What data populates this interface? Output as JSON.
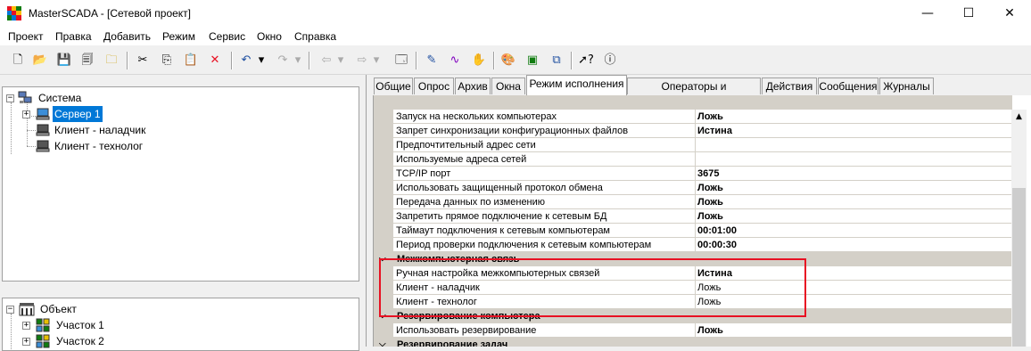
{
  "window": {
    "title": "MasterSCADA - [Сетевой проект]",
    "minimize": "—",
    "maximize": "☐",
    "close": "✕"
  },
  "menu": [
    "Проект",
    "Правка",
    "Добавить",
    "Режим",
    "Сервис",
    "Окно",
    "Справка"
  ],
  "toolbar": {
    "icons": [
      "new-file-icon",
      "open-folder-icon",
      "save-icon",
      "save-all-icon",
      "export-icon",
      "cut-icon",
      "copy-icon",
      "paste-icon",
      "delete-icon",
      "undo-icon",
      "undo-dropdown-icon",
      "redo-icon",
      "redo-dropdown-icon",
      "back-icon",
      "back-dropdown-icon",
      "forward-icon",
      "forward-dropdown-icon",
      "window-icon",
      "pen-icon",
      "signal-icon",
      "hand-icon",
      "palette-icon",
      "mode-icon",
      "run-icon",
      "help-pointer-icon",
      "info-icon"
    ]
  },
  "tree_top": {
    "root": "Система",
    "children": [
      {
        "label": "Сервер 1",
        "selected": true
      },
      {
        "label": "Клиент - наладчик"
      },
      {
        "label": "Клиент - технолог"
      }
    ]
  },
  "tree_bottom": {
    "root": "Объект",
    "children": [
      {
        "label": "Участок 1"
      },
      {
        "label": "Участок 2"
      }
    ]
  },
  "tabs": [
    "Общие",
    "Опрос",
    "Архив",
    "Окна",
    "Режим исполнения",
    "Операторы и безопасность",
    "Действия",
    "Сообщения",
    "Журналы"
  ],
  "active_tab": "Режим исполнения",
  "properties": [
    {
      "type": "prop",
      "name": "Запуск на нескольких компьютерах",
      "value": "Ложь",
      "bold": true
    },
    {
      "type": "prop",
      "name": "Запрет синхронизации конфигурационных файлов",
      "value": "Истина",
      "bold": true
    },
    {
      "type": "prop",
      "name": "Предпочтительный адрес сети",
      "value": "",
      "bold": false
    },
    {
      "type": "prop",
      "name": "Используемые адреса сетей",
      "value": "",
      "bold": false
    },
    {
      "type": "prop",
      "name": "TCP/IP порт",
      "value": "3675",
      "bold": true
    },
    {
      "type": "prop",
      "name": "Использовать защищенный протокол обмена",
      "value": "Ложь",
      "bold": true
    },
    {
      "type": "prop",
      "name": "Передача данных по изменению",
      "value": "Ложь",
      "bold": true
    },
    {
      "type": "prop",
      "name": "Запретить прямое подключение к сетевым БД",
      "value": "Ложь",
      "bold": true
    },
    {
      "type": "prop",
      "name": "Таймаут подключения к сетевым компьютерам",
      "value": "00:01:00",
      "bold": true
    },
    {
      "type": "prop",
      "name": "Период проверки подключения к сетевым компьютерам",
      "value": "00:00:30",
      "bold": true
    },
    {
      "type": "cat",
      "name": "Межкомпьютерная связь"
    },
    {
      "type": "prop",
      "name": "Ручная настройка межкомпьютерных связей",
      "value": "Истина",
      "bold": true
    },
    {
      "type": "prop",
      "name": "Клиент - наладчик",
      "value": "Ложь",
      "bold": false
    },
    {
      "type": "prop",
      "name": "Клиент - технолог",
      "value": "Ложь",
      "bold": false
    },
    {
      "type": "cat",
      "name": "Резервирование компьютера"
    },
    {
      "type": "prop",
      "name": "Использовать резервирование",
      "value": "Ложь",
      "bold": true
    },
    {
      "type": "cat",
      "name": "Резервирование задач"
    }
  ],
  "colors": {
    "selection": "#0078d7",
    "highlight_box": "#e81123",
    "category": "#d4d0c8"
  }
}
